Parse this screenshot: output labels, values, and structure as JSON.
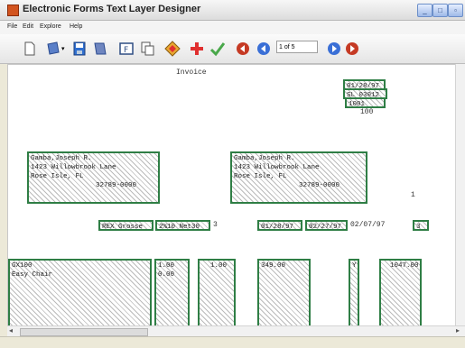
{
  "window": {
    "title": "Electronic Forms Text Layer Designer"
  },
  "menu": {
    "file": "File",
    "edit": "Edit",
    "explore": "Explore",
    "help": "Help"
  },
  "toolbar": {
    "page_indicator": "1 of 5"
  },
  "invoice": {
    "heading": "Invoice",
    "date_field": "01/28/97",
    "ref_field": "SL 03012",
    "acct_field": "1001",
    "acct_below": "100",
    "bill_to": "Gamba,Joseph R.\n1423 Willowbrook Lane\nRose Isle, FL\n                32789-0000",
    "ship_to": "Gamba,Joseph R.\n1423 Willowbrook Lane\nRose Isle, FL\n                32789-0000",
    "page_number": "1",
    "salesperson": "REX Grosse",
    "terms": "2%10 Net30",
    "terms_after": "3",
    "order_date": "01/28/97",
    "ship_date": "02/27/97",
    "due_date": "02/07/97",
    "ship_via": "3",
    "item_code": "GX100\nEasy Chair",
    "qty": "1.00\n0.00",
    "price": "1.00",
    "unit_price": "349.00",
    "tax_flag": "Y",
    "amount": "1047.00"
  },
  "colors": {
    "field_border": "#2f7e45",
    "accent_red": "#e03030",
    "accent_green": "#49a84a"
  }
}
